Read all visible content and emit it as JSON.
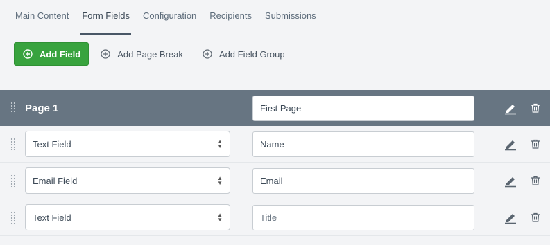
{
  "tabs": [
    {
      "label": "Main Content",
      "active": false
    },
    {
      "label": "Form Fields",
      "active": true
    },
    {
      "label": "Configuration",
      "active": false
    },
    {
      "label": "Recipients",
      "active": false
    },
    {
      "label": "Submissions",
      "active": false
    }
  ],
  "toolbar": {
    "add_field_label": "Add Field",
    "add_page_break_label": "Add Page Break",
    "add_field_group_label": "Add Field Group"
  },
  "page_header": {
    "title": "Page 1",
    "page_name_value": "First Page"
  },
  "fields": [
    {
      "type": "Text Field",
      "label_value": "Name",
      "placeholder": ""
    },
    {
      "type": "Email Field",
      "label_value": "Email",
      "placeholder": ""
    },
    {
      "type": "Text Field",
      "label_value": "",
      "placeholder": "Title"
    }
  ],
  "colors": {
    "primary_green": "#38a33e",
    "header_bar": "#677582",
    "background": "#f3f4f6"
  },
  "icons": {
    "add": "plus-circle-icon",
    "drag": "drag-handle-icon",
    "edit": "pencil-icon",
    "delete": "trash-icon",
    "select": "select-arrows-icon"
  }
}
